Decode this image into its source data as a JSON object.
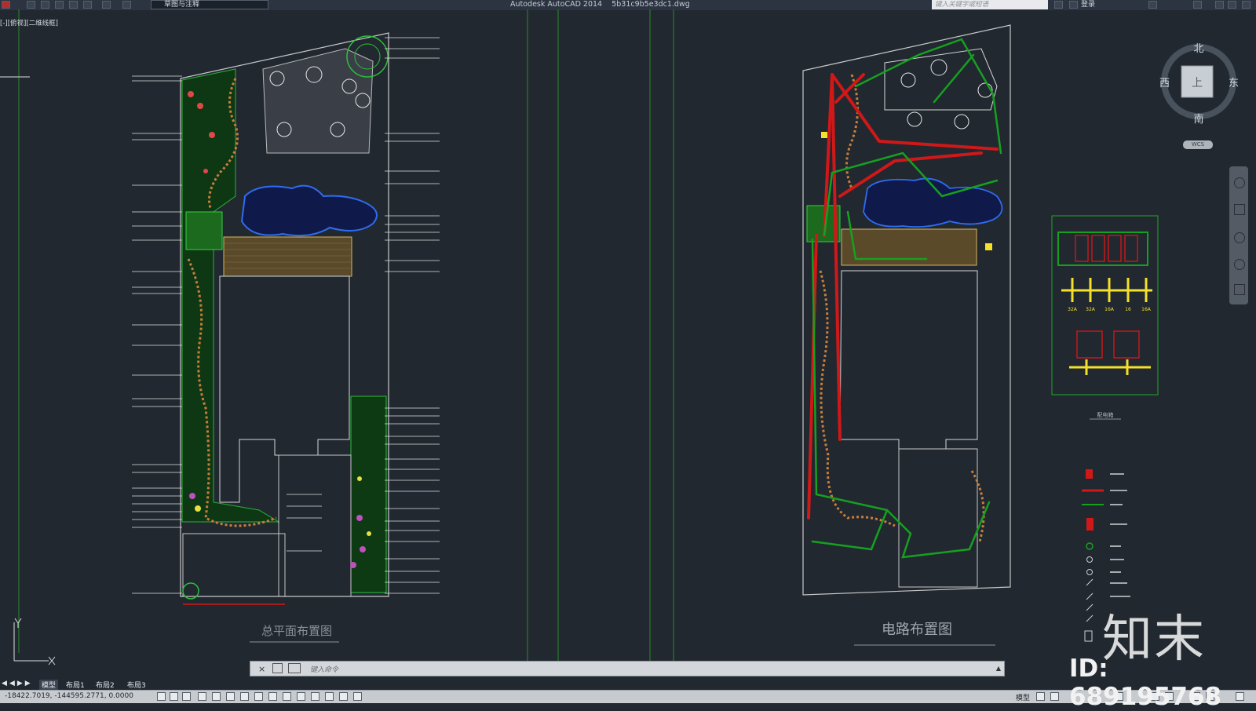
{
  "titlebar": {
    "workspace": "草图与注释",
    "app_title": "Autodesk AutoCAD 2014",
    "filename": "5b31c9b5e3dc1.dwg",
    "search_placeholder": "键入关键字或短语",
    "login": "登录"
  },
  "viewport_label": "[-][俯视][二维线框]",
  "viewcube": {
    "north": "北",
    "south": "南",
    "east": "东",
    "west": "西",
    "top": "上",
    "wcs": "WCS"
  },
  "drawings": {
    "left_caption": "总平面布置图",
    "right_caption": "电路布置图",
    "panel_caption": "配电箱",
    "panel_ratings": [
      "32A",
      "32A",
      "16A",
      "16",
      "16A"
    ]
  },
  "command_line": {
    "placeholder": "键入命令"
  },
  "layout_tabs": [
    "模型",
    "布局1",
    "布局2",
    "布局3"
  ],
  "status": {
    "coordinates": "-18422.7019, -144595.2771, 0.0000",
    "model_label": "模型",
    "scale": "1:1"
  },
  "watermarks": {
    "brand": "知末",
    "id": "ID: 689195768"
  },
  "colors": {
    "background": "#212830",
    "plant_green": "#1fa82a",
    "wire_red": "#d01818",
    "wire_green": "#16a020",
    "water_blue": "#2f6cf0",
    "panel_yellow": "#f5e02a"
  }
}
